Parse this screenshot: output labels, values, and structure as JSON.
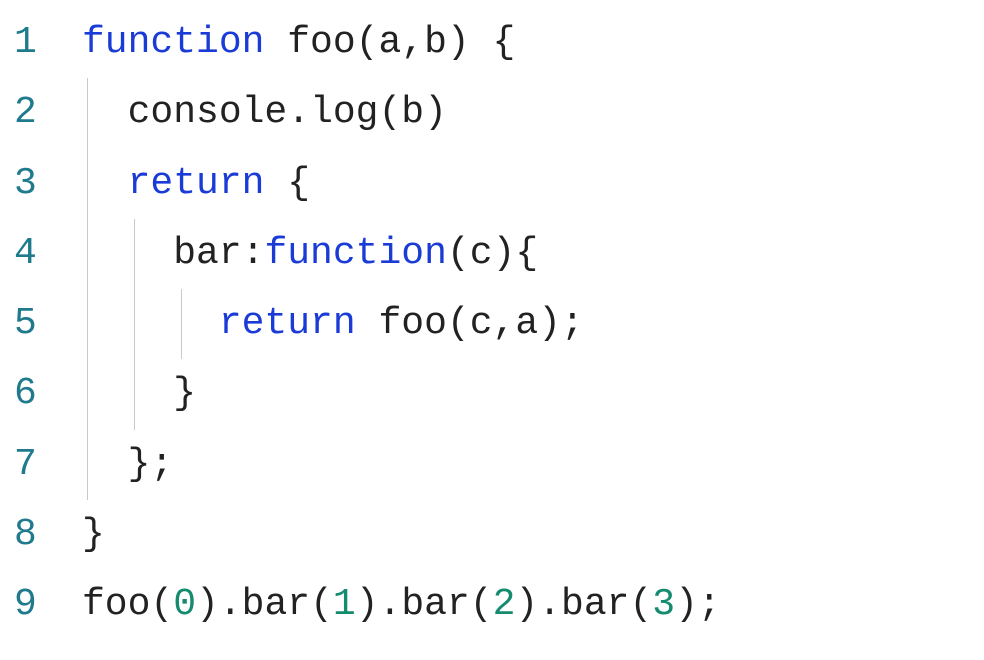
{
  "editor": {
    "lines": [
      {
        "num": "1",
        "indentGuides": [],
        "tokens": [
          {
            "cls": "tok-keyword",
            "text": "function"
          },
          {
            "cls": "tok-default",
            "text": " "
          },
          {
            "cls": "tok-identifier",
            "text": "foo"
          },
          {
            "cls": "tok-punct",
            "text": "("
          },
          {
            "cls": "tok-identifier",
            "text": "a"
          },
          {
            "cls": "tok-punct",
            "text": ","
          },
          {
            "cls": "tok-identifier",
            "text": "b"
          },
          {
            "cls": "tok-punct",
            "text": ")"
          },
          {
            "cls": "tok-default",
            "text": " "
          },
          {
            "cls": "tok-punct",
            "text": "{"
          }
        ]
      },
      {
        "num": "2",
        "indentGuides": [
          1
        ],
        "tokens": [
          {
            "cls": "tok-default",
            "text": "  "
          },
          {
            "cls": "tok-identifier",
            "text": "console"
          },
          {
            "cls": "tok-punct",
            "text": "."
          },
          {
            "cls": "tok-identifier",
            "text": "log"
          },
          {
            "cls": "tok-punct",
            "text": "("
          },
          {
            "cls": "tok-identifier",
            "text": "b"
          },
          {
            "cls": "tok-punct",
            "text": ")"
          }
        ]
      },
      {
        "num": "3",
        "indentGuides": [
          1
        ],
        "tokens": [
          {
            "cls": "tok-default",
            "text": "  "
          },
          {
            "cls": "tok-keyword",
            "text": "return"
          },
          {
            "cls": "tok-default",
            "text": " "
          },
          {
            "cls": "tok-punct",
            "text": "{"
          }
        ]
      },
      {
        "num": "4",
        "indentGuides": [
          1,
          2
        ],
        "tokens": [
          {
            "cls": "tok-default",
            "text": "    "
          },
          {
            "cls": "tok-identifier",
            "text": "bar"
          },
          {
            "cls": "tok-punct",
            "text": ":"
          },
          {
            "cls": "tok-keyword",
            "text": "function"
          },
          {
            "cls": "tok-punct",
            "text": "("
          },
          {
            "cls": "tok-identifier",
            "text": "c"
          },
          {
            "cls": "tok-punct",
            "text": ")"
          },
          {
            "cls": "tok-punct",
            "text": "{"
          }
        ]
      },
      {
        "num": "5",
        "indentGuides": [
          1,
          2,
          3
        ],
        "tokens": [
          {
            "cls": "tok-default",
            "text": "      "
          },
          {
            "cls": "tok-keyword",
            "text": "return"
          },
          {
            "cls": "tok-default",
            "text": " "
          },
          {
            "cls": "tok-identifier",
            "text": "foo"
          },
          {
            "cls": "tok-punct",
            "text": "("
          },
          {
            "cls": "tok-identifier",
            "text": "c"
          },
          {
            "cls": "tok-punct",
            "text": ","
          },
          {
            "cls": "tok-identifier",
            "text": "a"
          },
          {
            "cls": "tok-punct",
            "text": ")"
          },
          {
            "cls": "tok-punct",
            "text": ";"
          }
        ]
      },
      {
        "num": "6",
        "indentGuides": [
          1,
          2
        ],
        "tokens": [
          {
            "cls": "tok-default",
            "text": "    "
          },
          {
            "cls": "tok-punct",
            "text": "}"
          }
        ]
      },
      {
        "num": "7",
        "indentGuides": [
          1
        ],
        "tokens": [
          {
            "cls": "tok-default",
            "text": "  "
          },
          {
            "cls": "tok-punct",
            "text": "}"
          },
          {
            "cls": "tok-punct",
            "text": ";"
          }
        ]
      },
      {
        "num": "8",
        "indentGuides": [],
        "tokens": [
          {
            "cls": "tok-punct",
            "text": "}"
          }
        ]
      },
      {
        "num": "9",
        "indentGuides": [],
        "tokens": [
          {
            "cls": "tok-identifier",
            "text": "foo"
          },
          {
            "cls": "tok-punct",
            "text": "("
          },
          {
            "cls": "tok-number",
            "text": "0"
          },
          {
            "cls": "tok-punct",
            "text": ")"
          },
          {
            "cls": "tok-punct",
            "text": "."
          },
          {
            "cls": "tok-identifier",
            "text": "bar"
          },
          {
            "cls": "tok-punct",
            "text": "("
          },
          {
            "cls": "tok-number",
            "text": "1"
          },
          {
            "cls": "tok-punct",
            "text": ")"
          },
          {
            "cls": "tok-punct",
            "text": "."
          },
          {
            "cls": "tok-identifier",
            "text": "bar"
          },
          {
            "cls": "tok-punct",
            "text": "("
          },
          {
            "cls": "tok-number",
            "text": "2"
          },
          {
            "cls": "tok-punct",
            "text": ")"
          },
          {
            "cls": "tok-punct",
            "text": "."
          },
          {
            "cls": "tok-identifier",
            "text": "bar"
          },
          {
            "cls": "tok-punct",
            "text": "("
          },
          {
            "cls": "tok-number",
            "text": "3"
          },
          {
            "cls": "tok-punct",
            "text": ")"
          },
          {
            "cls": "tok-punct",
            "text": ";"
          }
        ]
      }
    ],
    "indentGuidePx": 47
  }
}
